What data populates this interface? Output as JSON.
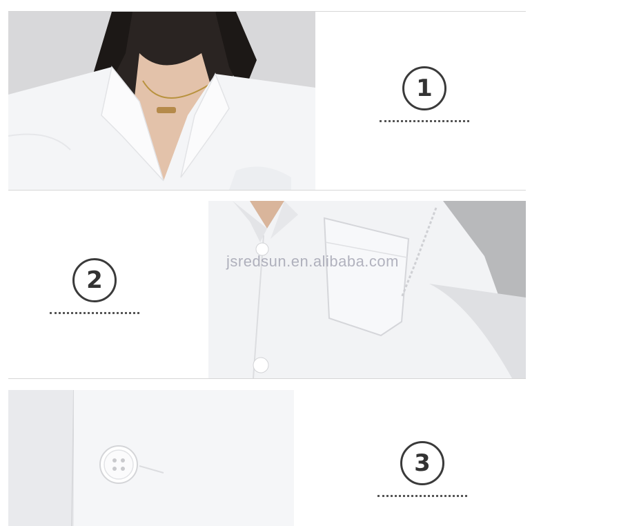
{
  "panels": [
    {
      "number": "1",
      "description_icon": "collar-closeup"
    },
    {
      "number": "2",
      "description_icon": "pocket-closeup"
    },
    {
      "number": "3",
      "description_icon": "button-closeup"
    }
  ],
  "watermark": "jsredsun.en.alibaba.com",
  "colors": {
    "circle_stroke": "#3a3a3a",
    "dots": "#555555",
    "divider": "#d6d6d6"
  }
}
